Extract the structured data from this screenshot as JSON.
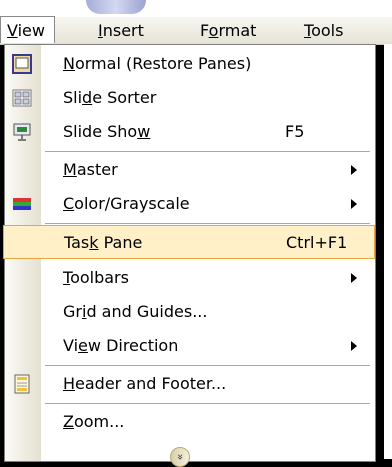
{
  "menubar": {
    "items": [
      {
        "label": "View",
        "underline": "V",
        "active": true
      },
      {
        "label": "Insert",
        "underline": "I"
      },
      {
        "label": "Format",
        "underline": "o"
      },
      {
        "label": "Tools",
        "underline": "T"
      }
    ]
  },
  "menu": {
    "items": [
      {
        "id": "normal",
        "pre": "",
        "ul": "N",
        "post": "ormal (Restore Panes)",
        "shortcut": "",
        "submenu": false,
        "icon": "normal-view-icon"
      },
      {
        "id": "slide-sorter",
        "pre": "Sli",
        "ul": "d",
        "post": "e Sorter",
        "shortcut": "",
        "submenu": false,
        "icon": "slide-sorter-icon"
      },
      {
        "id": "slide-show",
        "pre": "Slide Sho",
        "ul": "w",
        "post": "",
        "shortcut": "F5",
        "submenu": false,
        "icon": "slide-show-icon"
      },
      {
        "id": "master",
        "pre": "",
        "ul": "M",
        "post": "aster",
        "shortcut": "",
        "submenu": true,
        "icon": ""
      },
      {
        "id": "color-grayscale",
        "pre": "",
        "ul": "C",
        "post": "olor/Grayscale",
        "shortcut": "",
        "submenu": true,
        "icon": "color-grayscale-icon"
      },
      {
        "id": "task-pane",
        "pre": "Tas",
        "ul": "k",
        "post": " Pane",
        "shortcut": "Ctrl+F1",
        "submenu": false,
        "icon": "",
        "highlighted": true
      },
      {
        "id": "toolbars",
        "pre": "",
        "ul": "T",
        "post": "oolbars",
        "shortcut": "",
        "submenu": true,
        "icon": ""
      },
      {
        "id": "grid-guides",
        "pre": "Gr",
        "ul": "i",
        "post": "d and Guides...",
        "shortcut": "",
        "submenu": false,
        "icon": ""
      },
      {
        "id": "view-direction",
        "pre": "Vi",
        "ul": "e",
        "post": "w Direction",
        "shortcut": "",
        "submenu": true,
        "icon": ""
      },
      {
        "id": "header-footer",
        "pre": "",
        "ul": "H",
        "post": "eader and Footer...",
        "shortcut": "",
        "submenu": false,
        "icon": "header-footer-icon"
      },
      {
        "id": "zoom",
        "pre": "",
        "ul": "Z",
        "post": "oom...",
        "shortcut": "",
        "submenu": false,
        "icon": ""
      }
    ],
    "expand_icon": "chevron-double-down-icon"
  },
  "colors": {
    "highlight_bg": "#fff0c8",
    "highlight_border": "#e8a640",
    "menubar_bg": "#ece9d8"
  }
}
